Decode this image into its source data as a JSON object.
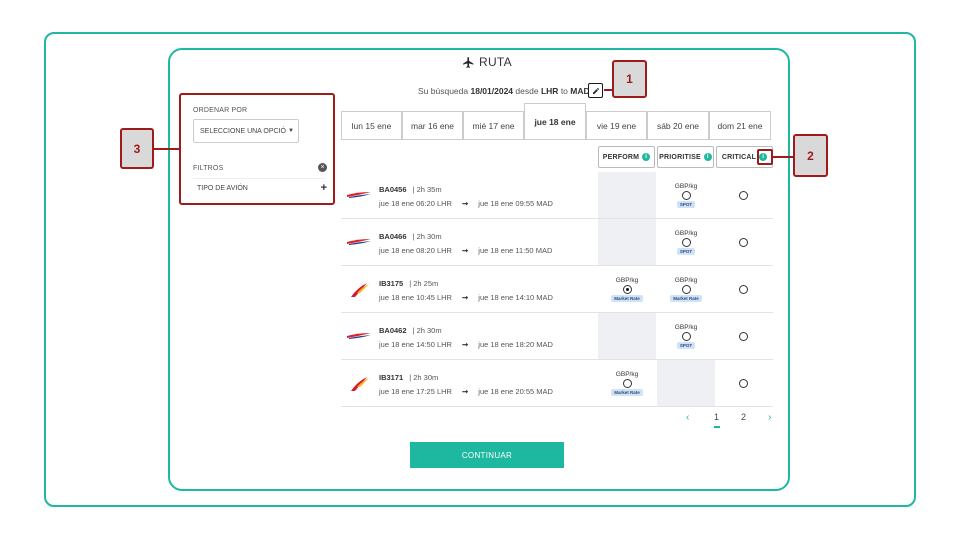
{
  "header": {
    "title": "RUTA",
    "icon": "plane-icon"
  },
  "search": {
    "prefix": "Su búsqueda",
    "date": "18/01/2024",
    "from_word": "desde",
    "origin": "LHR",
    "to_word": "to",
    "destination": "MAD"
  },
  "sidebar": {
    "sort_label": "ORDENAR POR",
    "sort_select": "SELECCIONE UNA OPCIÓ",
    "filters_label": "FILTROS",
    "filter_item": "TIPO DE AVIÓN",
    "filter_plus": "+"
  },
  "tabs": [
    {
      "label": "lun 15 ene",
      "active": false
    },
    {
      "label": "mar 16 ene",
      "active": false
    },
    {
      "label": "mié 17 ene",
      "active": false
    },
    {
      "label": "jue 18 ene",
      "active": true
    },
    {
      "label": "vie 19 ene",
      "active": false
    },
    {
      "label": "sáb 20 ene",
      "active": false
    },
    {
      "label": "dom 21 ene",
      "active": false
    }
  ],
  "columns": {
    "perform": "PERFORM",
    "prioritise": "PRIORITISE",
    "critical": "CRITICAL",
    "info_glyph": "i"
  },
  "flights": [
    {
      "airline": "BA",
      "number": "BA0456",
      "duration": "| 2h 35m",
      "dep": "jue 18 ene 06:20 LHR",
      "arrow": "➞",
      "arr": "jue 18 ene 09:55 MAD",
      "perform": null,
      "prioritise": {
        "price": "GBP/kg",
        "badge": "SPOT",
        "selected": false
      }
    },
    {
      "airline": "BA",
      "number": "BA0466",
      "duration": "| 2h 30m",
      "dep": "jue 18 ene 08:20 LHR",
      "arrow": "➞",
      "arr": "jue 18 ene 11:50 MAD",
      "perform": null,
      "prioritise": {
        "price": "GBP/kg",
        "badge": "SPOT",
        "selected": false
      }
    },
    {
      "airline": "IB",
      "number": "IB3175",
      "duration": "| 2h 25m",
      "dep": "jue 18 ene 10:45 LHR",
      "arrow": "➞",
      "arr": "jue 18 ene 14:10 MAD",
      "perform": {
        "price": "GBP/kg",
        "badge": "Market Rate",
        "selected": true
      },
      "prioritise": {
        "price": "GBP/kg",
        "badge": "Market Rate",
        "selected": false
      }
    },
    {
      "airline": "BA",
      "number": "BA0462",
      "duration": "| 2h 30m",
      "dep": "jue 18 ene 14:50 LHR",
      "arrow": "➞",
      "arr": "jue 18 ene 18:20 MAD",
      "perform": null,
      "prioritise": {
        "price": "GBP/kg",
        "badge": "SPOT",
        "selected": false
      }
    },
    {
      "airline": "IB",
      "number": "IB3171",
      "duration": "| 2h 30m",
      "dep": "jue 18 ene 17:25 LHR",
      "arrow": "➞",
      "arr": "jue 18 ene 20:55 MAD",
      "perform": {
        "price": "GBP/kg",
        "badge": "Market Rate",
        "selected": false
      },
      "prioritise": null
    }
  ],
  "pagination": {
    "prev": "‹",
    "pages": [
      "1",
      "2"
    ],
    "current": "1",
    "next": "›"
  },
  "continue_label": "CONTINUAR",
  "callouts": [
    "1",
    "2",
    "3"
  ],
  "colors": {
    "accent": "#1db89f",
    "callout": "#9e1b1b",
    "ba_red": "#d8232a",
    "ba_blue": "#2a3f8f",
    "ib_red": "#d7192d",
    "ib_yellow": "#f6b21b"
  }
}
